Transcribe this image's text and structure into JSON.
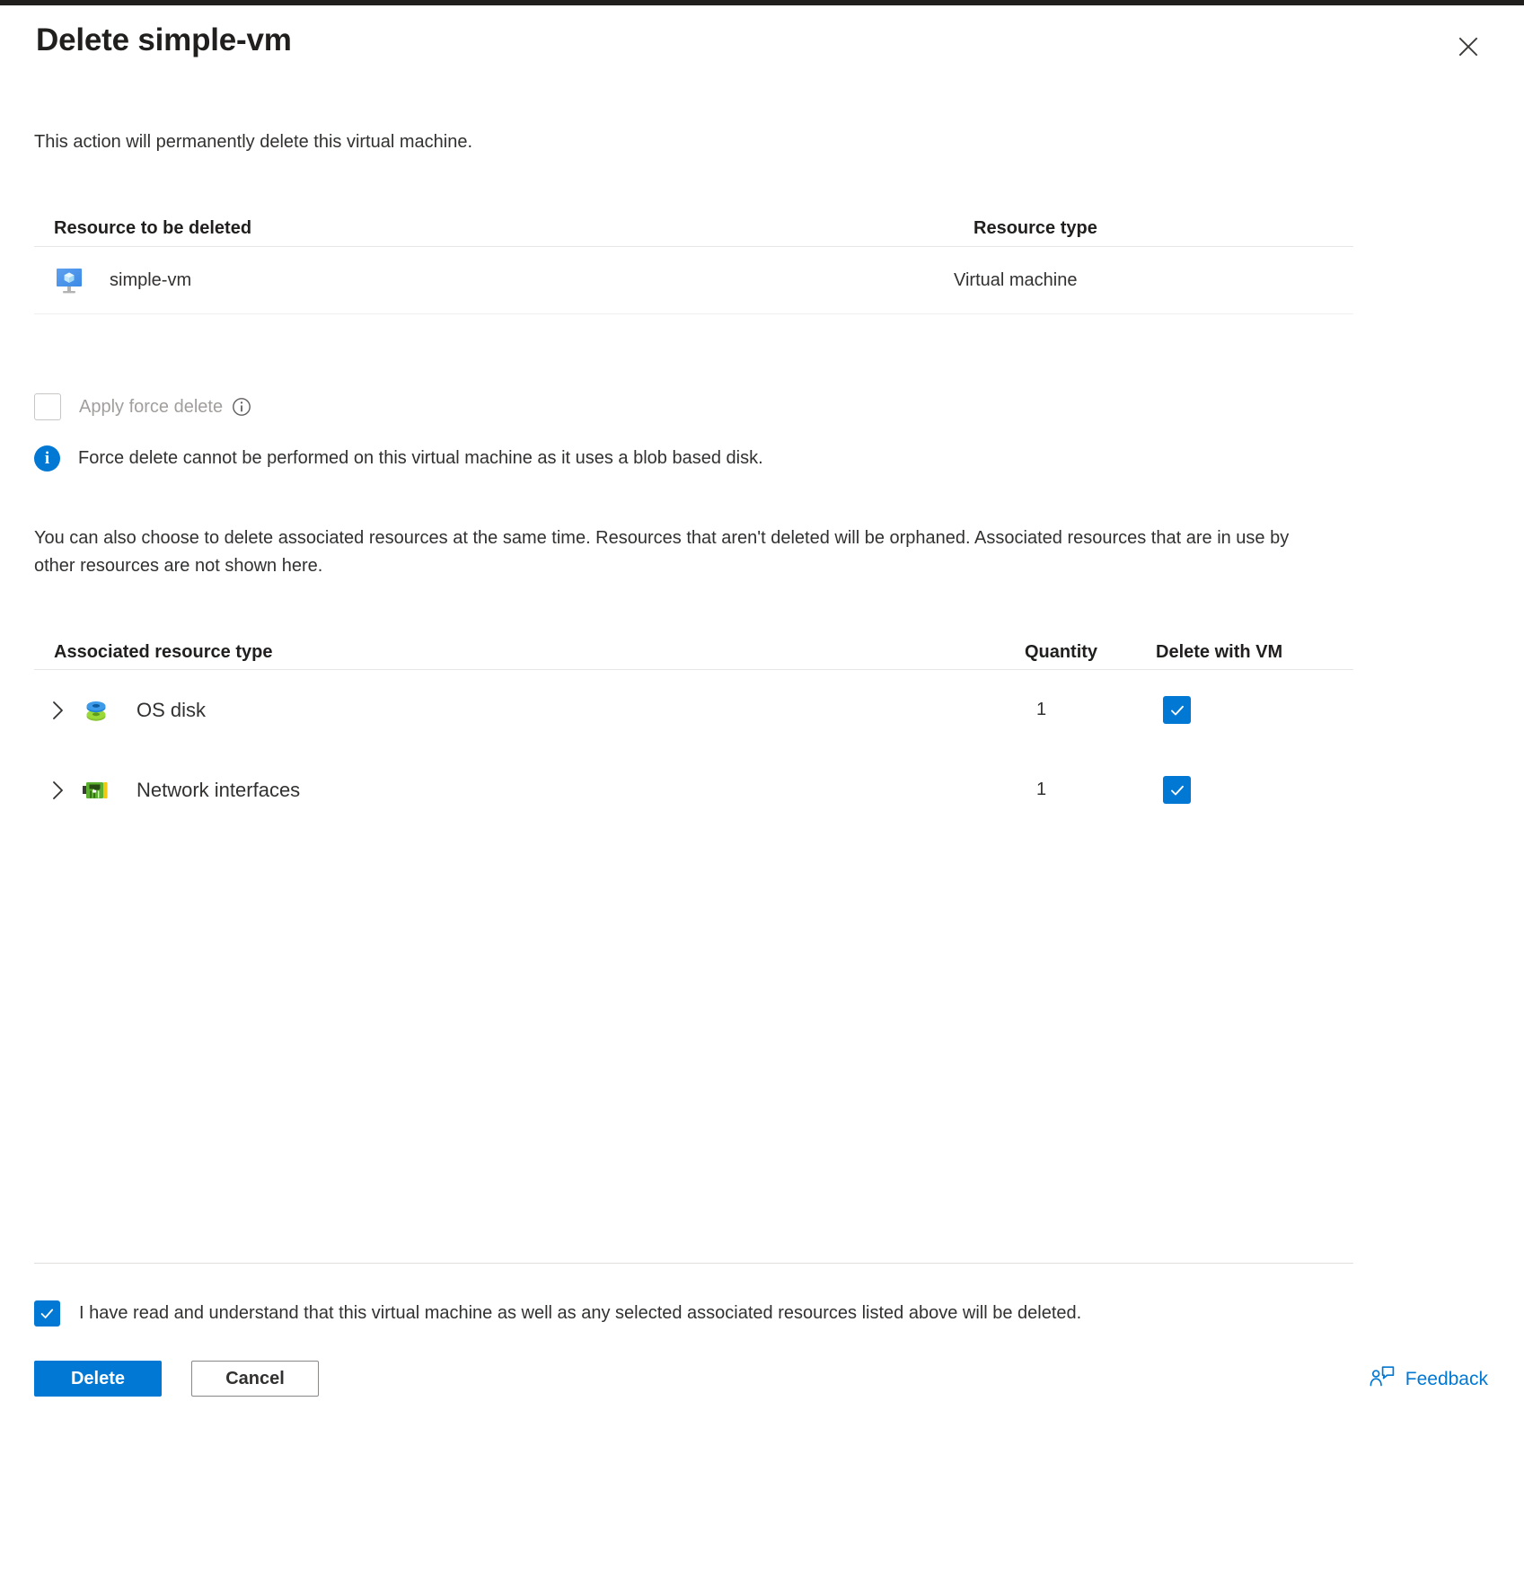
{
  "dialog": {
    "title": "Delete simple-vm",
    "close_icon": "close-icon",
    "intro": "This action will permanently delete this virtual machine."
  },
  "resource_table": {
    "columns": [
      "Resource to be deleted",
      "Resource type"
    ],
    "rows": [
      {
        "icon": "virtual-machine-icon",
        "name": "simple-vm",
        "type": "Virtual machine"
      }
    ]
  },
  "force_delete": {
    "label": "Apply force delete",
    "checked": false,
    "disabled": true,
    "info_icon": "info-outline-icon",
    "message": "Force delete cannot be performed on this virtual machine as it uses a blob based disk.",
    "message_icon": "info-filled-icon",
    "message_badge_glyph": "i"
  },
  "associated_intro": "You can also choose to delete associated resources at the same time. Resources that aren't deleted will be orphaned. Associated resources that are in use by other resources are not shown here.",
  "associated_table": {
    "columns": [
      "Associated resource type",
      "Quantity",
      "Delete with VM"
    ],
    "rows": [
      {
        "expand_icon": "chevron-right-icon",
        "icon": "os-disk-icon",
        "label": "OS disk",
        "quantity": "1",
        "delete_with_vm": true
      },
      {
        "expand_icon": "chevron-right-icon",
        "icon": "network-interface-icon",
        "label": "Network interfaces",
        "quantity": "1",
        "delete_with_vm": true
      }
    ]
  },
  "acknowledgement": {
    "checked": true,
    "text": "I have read and understand that this virtual machine as well as any selected associated resources listed above will be deleted."
  },
  "footer": {
    "delete_label": "Delete",
    "cancel_label": "Cancel",
    "feedback_label": "Feedback",
    "feedback_icon": "feedback-person-icon"
  },
  "colors": {
    "accent": "#0078d4",
    "text": "#323130",
    "disabled_text": "#a19f9d",
    "border": "#e6e6e6",
    "top_strip": "#201f1e"
  }
}
